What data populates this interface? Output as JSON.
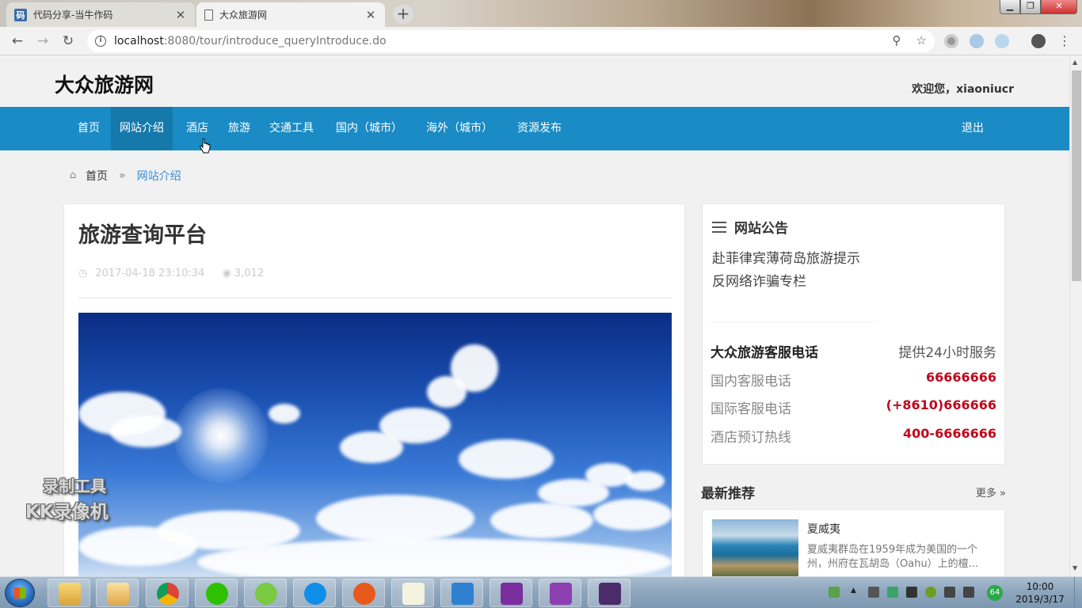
{
  "browser": {
    "tabs": [
      {
        "title": "代码分享-当牛作码",
        "favicon": "码",
        "active": false
      },
      {
        "title": "大众旅游网",
        "active": true
      }
    ],
    "url_host": "localhost",
    "url_rest": ":8080/tour/introduce_queryIntroduce.do",
    "window_controls": [
      "minimize-icon",
      "maximize-icon",
      "close-icon"
    ]
  },
  "site": {
    "logo": "大众旅游网",
    "welcome": "欢迎您，xiaoniucr",
    "nav": [
      "首页",
      "网站介绍",
      "酒店",
      "旅游",
      "交通工具",
      "国内（城市）",
      "海外（城市）",
      "资源发布"
    ],
    "nav_active": "网站介绍",
    "logout": "退出",
    "brand_color": "#1a8bc4"
  },
  "breadcrumb": {
    "home": "首页",
    "separator": "»",
    "current": "网站介绍"
  },
  "article": {
    "title": "旅游查询平台",
    "date": "2017-04-18 23:10:34",
    "views": "3,012"
  },
  "notice": {
    "title": "网站公告",
    "items": [
      "赴菲律宾薄荷岛旅游提示",
      "反网络诈骗专栏"
    ]
  },
  "service": {
    "title": "大众旅游客服电话",
    "subtitle": "提供24小时服务",
    "rows": [
      {
        "label": "国内客服电话",
        "value": "66666666"
      },
      {
        "label": "国际客服电话",
        "value": "(+8610)666666"
      },
      {
        "label": "酒店预订热线",
        "value": "400-6666666"
      }
    ],
    "value_color": "#c0081b"
  },
  "recommend": {
    "title": "最新推荐",
    "more": "更多 »",
    "item": {
      "name": "夏威夷",
      "desc": "夏威夷群岛在1959年成为美国的一个州，州府在瓦胡岛（Oahu）上的檀..."
    }
  },
  "watermark": {
    "line1": "录制工具",
    "line2": "KK录像机"
  },
  "taskbar": {
    "time": "10:00",
    "date": "2019/3/17",
    "badge": "64"
  }
}
